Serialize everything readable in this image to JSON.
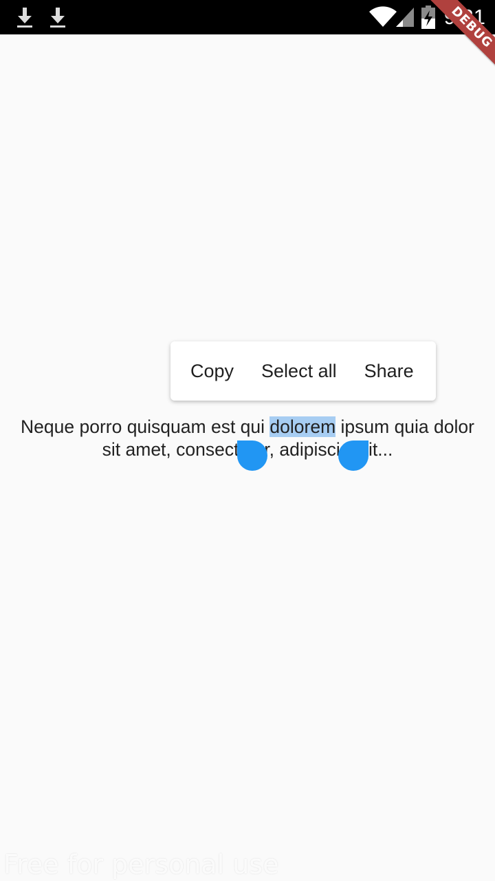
{
  "status_bar": {
    "time": "9:21",
    "icons": [
      "download-icon",
      "download-icon",
      "wifi-icon",
      "signal-icon",
      "battery-charging-icon"
    ]
  },
  "debug_banner": {
    "label": "DEBUG"
  },
  "selection_toolbar": {
    "copy_label": "Copy",
    "select_all_label": "Select all",
    "share_label": "Share"
  },
  "paragraph": {
    "line1_before": "Neque porro quisquam est qui ",
    "line1_selected": "dolorem",
    "line1_after": " ipsum quia dolor",
    "line2": "sit amet, consectetur, adipisci velit..."
  },
  "watermark": {
    "text": "Free for personal use"
  },
  "colors": {
    "accent": "#2196f3",
    "selection": "#a7cdf2",
    "background": "#fafafa",
    "banner": "#b0413e"
  }
}
